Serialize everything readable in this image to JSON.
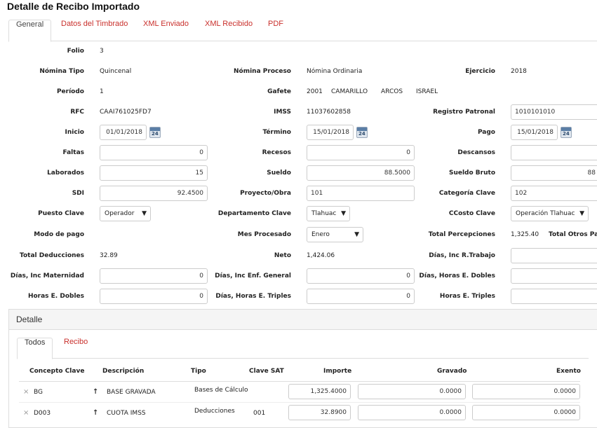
{
  "page_title": "Detalle de Recibo Importado",
  "tabs": [
    "General",
    "Datos del Timbrado",
    "XML Enviado",
    "XML Recibido",
    "PDF"
  ],
  "form": {
    "folio": {
      "label": "Folio",
      "value": "3"
    },
    "nomina_tipo": {
      "label": "Nómina Tipo",
      "value": "Quincenal"
    },
    "nomina_proceso": {
      "label": "Nómina Proceso",
      "value": "Nómina Ordinaria"
    },
    "ejercicio": {
      "label": "Ejercicio",
      "value": "2018"
    },
    "periodo": {
      "label": "Período",
      "value": "1"
    },
    "gafete": {
      "label": "Gafete",
      "value": "2001",
      "nombre": "CAMARILLO",
      "apellido": "ARCOS",
      "nombre2": "ISRAEL"
    },
    "rfc": {
      "label": "RFC",
      "value": "CAAI761025FD7"
    },
    "imss": {
      "label": "IMSS",
      "value": "11037602858"
    },
    "registro_patronal": {
      "label": "Registro Patronal",
      "value": "1010101010"
    },
    "inicio": {
      "label": "Inicio",
      "value": "01/01/2018"
    },
    "termino": {
      "label": "Término",
      "value": "15/01/2018"
    },
    "pago": {
      "label": "Pago",
      "value": "15/01/2018"
    },
    "faltas": {
      "label": "Faltas",
      "value": "0"
    },
    "recesos": {
      "label": "Recesos",
      "value": "0"
    },
    "descansos": {
      "label": "Descansos",
      "value": ""
    },
    "laborados": {
      "label": "Laborados",
      "value": "15"
    },
    "sueldo": {
      "label": "Sueldo",
      "value": "88.5000"
    },
    "sueldo_bruto": {
      "label": "Sueldo Bruto",
      "value": "88"
    },
    "sdi": {
      "label": "SDI",
      "value": "92.4500"
    },
    "proyecto_obra": {
      "label": "Proyecto/Obra",
      "value": "101"
    },
    "categoria_clave": {
      "label": "Categoría Clave",
      "value": "102"
    },
    "puesto_clave": {
      "label": "Puesto Clave",
      "value": "Operador"
    },
    "departamento_clave": {
      "label": "Departamento Clave",
      "value": "Tlahuac"
    },
    "ccosto_clave": {
      "label": "CCosto Clave",
      "value": "Operación Tlahuac"
    },
    "modo_pago": {
      "label": "Modo de pago",
      "value": ""
    },
    "mes_procesado": {
      "label": "Mes Procesado",
      "value": "Enero"
    },
    "total_percepciones": {
      "label": "Total Percepciones",
      "value": "1,325.40"
    },
    "total_otros_pagos": {
      "label": "Total Otros Pag",
      "value": ""
    },
    "total_deducciones": {
      "label": "Total Deducciones",
      "value": "32.89"
    },
    "neto": {
      "label": "Neto",
      "value": "1,424.06"
    },
    "dias_inc_r_trabajo": {
      "label": "Días, Inc R.Trabajo",
      "value": ""
    },
    "dias_inc_maternidad": {
      "label": "Días, Inc Maternidad",
      "value": "0"
    },
    "dias_inc_enf_general": {
      "label": "Días, Inc Enf. General",
      "value": "0"
    },
    "dias_horas_e_dobles": {
      "label": "Días, Horas E. Dobles",
      "value": ""
    },
    "horas_e_dobles": {
      "label": "Horas E. Dobles",
      "value": "0"
    },
    "dias_horas_e_triples": {
      "label": "Días, Horas E. Triples",
      "value": "0"
    },
    "horas_e_triples": {
      "label": "Horas E. Triples",
      "value": ""
    }
  },
  "detalle": {
    "title": "Detalle",
    "subtabs": [
      "Todos",
      "Recibo"
    ],
    "columns": [
      "Concepto Clave",
      "Descripción",
      "Tipo",
      "Clave SAT",
      "Importe",
      "Gravado",
      "Exento"
    ],
    "rows": [
      {
        "clave": "BG",
        "descripcion": "BASE GRAVADA",
        "tipo": "Bases de Cálculo",
        "clave_sat": "",
        "importe": "1,325.4000",
        "gravado": "0.0000",
        "exento": "0.0000"
      },
      {
        "clave": "D003",
        "descripcion": "CUOTA IMSS",
        "tipo": "Deducciones",
        "clave_sat": "001",
        "importe": "32.8900",
        "gravado": "0.0000",
        "exento": "0.0000"
      }
    ]
  }
}
